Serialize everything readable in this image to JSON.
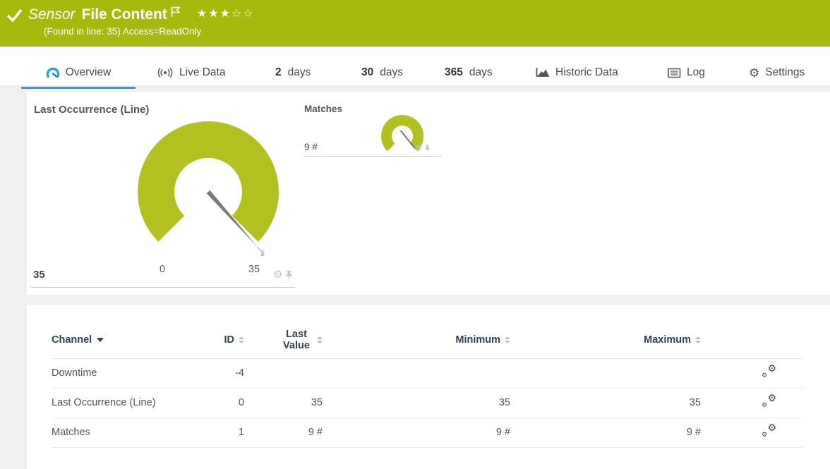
{
  "colors": {
    "brand_green": "#a8b90e",
    "gauge_green": "#b2c120",
    "accent_blue": "#2a9fd8"
  },
  "icons": {
    "gear": "⚙"
  },
  "header": {
    "kind_label": "Sensor",
    "title": "File Content",
    "message": "(Found in line: 35) Access=ReadOnly",
    "stars_filled": "★★★",
    "stars_empty": "☆☆"
  },
  "tabs": [
    {
      "label": "Overview"
    },
    {
      "label": "Live Data"
    },
    {
      "num": "2",
      "label": "days"
    },
    {
      "num": "30",
      "label": "days"
    },
    {
      "num": "365",
      "label": "days"
    },
    {
      "label": "Historic Data"
    },
    {
      "label": "Log"
    },
    {
      "label": "Settings"
    }
  ],
  "gauges": {
    "main": {
      "title": "Last Occurrence (Line)",
      "value": "35",
      "scale_min": "0",
      "scale_max": "35",
      "mean_marker": "x̄"
    },
    "matches": {
      "title": "Matches",
      "value": "9 #"
    }
  },
  "table": {
    "columns": {
      "channel": "Channel",
      "id": "ID",
      "last_value": "Last Value",
      "minimum": "Minimum",
      "maximum": "Maximum"
    },
    "rows": [
      {
        "channel": "Downtime",
        "id": "-4",
        "last": "",
        "min": "",
        "max": ""
      },
      {
        "channel": "Last Occurrence (Line)",
        "id": "0",
        "last": "35",
        "min": "35",
        "max": "35"
      },
      {
        "channel": "Matches",
        "id": "1",
        "last": "9 #",
        "min": "9 #",
        "max": "9 #"
      }
    ]
  }
}
